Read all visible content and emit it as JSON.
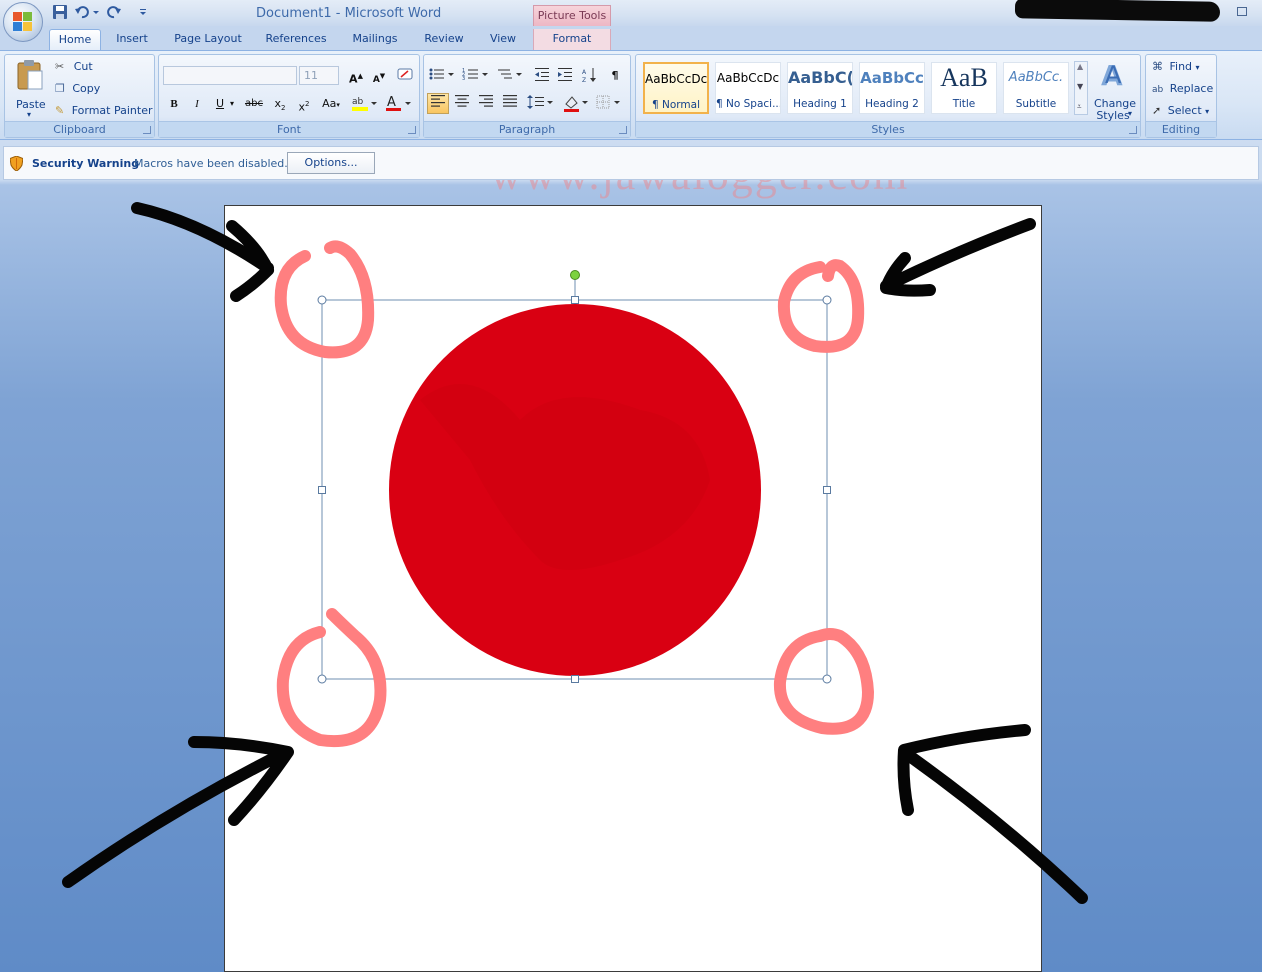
{
  "window": {
    "title": "Document1  -  Microsoft Word",
    "contextual_tab_group": "Picture Tools"
  },
  "tabs": [
    "Home",
    "Insert",
    "Page Layout",
    "References",
    "Mailings",
    "Review",
    "View",
    "Format"
  ],
  "active_tab": "Home",
  "clipboard": {
    "paste": "Paste",
    "cut": "Cut",
    "copy": "Copy",
    "format_painter": "Format Painter",
    "label": "Clipboard"
  },
  "font": {
    "font_name": "",
    "font_size": "11",
    "label": "Font"
  },
  "paragraph": {
    "label": "Paragraph"
  },
  "styles": {
    "items": [
      {
        "sample": "AaBbCcDc",
        "name": "¶ Normal"
      },
      {
        "sample": "AaBbCcDc",
        "name": "¶ No Spaci..."
      },
      {
        "sample": "AaBbC(",
        "name": "Heading 1"
      },
      {
        "sample": "AaBbCc",
        "name": "Heading 2"
      },
      {
        "sample": "AaB",
        "name": "Title"
      },
      {
        "sample": "AaBbCc.",
        "name": "Subtitle"
      }
    ],
    "change_styles_line1": "Change",
    "change_styles_line2": "Styles",
    "label": "Styles"
  },
  "editing": {
    "find": "Find",
    "replace": "Replace",
    "select": "Select",
    "label": "Editing"
  },
  "watermark": "www.jawalogger.com",
  "security": {
    "title": "Security Warning",
    "message": "Macros have been disabled.",
    "options": "Options..."
  },
  "colors": {
    "circle_red": "#d90012",
    "annotation_pink": "#ff7f80",
    "annotation_black": "#050505",
    "selection_border": "#6f8fb0",
    "rotate_handle": "#7cd23f"
  }
}
